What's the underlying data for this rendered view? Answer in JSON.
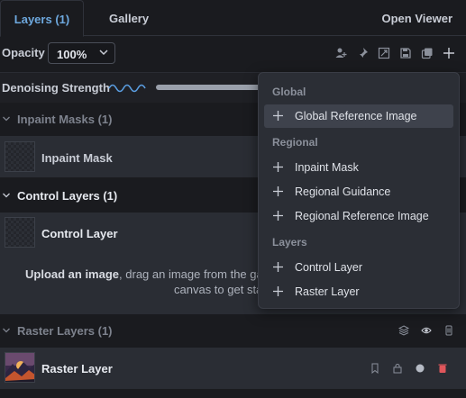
{
  "tabs": {
    "layers": "Layers (1)",
    "gallery": "Gallery",
    "open_viewer": "Open Viewer"
  },
  "opacity": {
    "label": "Opacity",
    "value": "100%"
  },
  "denoising": {
    "label": "Denoising Strength"
  },
  "sections": {
    "inpaint_masks": {
      "title": "Inpaint Masks (1)",
      "layer_name": "Inpaint Mask"
    },
    "control_layers": {
      "title": "Control Layers (1)",
      "layer_name": "Control Layer",
      "upload_bold": "Upload an image",
      "upload_rest": ", drag an image from the gal",
      "upload_line2": "canvas to get sta"
    },
    "raster_layers": {
      "title": "Raster Layers (1)",
      "layer_name": "Raster Layer"
    }
  },
  "menu": {
    "global_label": "Global",
    "global_items": [
      "Global Reference Image"
    ],
    "regional_label": "Regional",
    "regional_items": [
      "Inpaint Mask",
      "Regional Guidance",
      "Regional Reference Image"
    ],
    "layers_label": "Layers",
    "layers_items": [
      "Control Layer",
      "Raster Layer"
    ],
    "highlighted": "Global Reference Image"
  },
  "colors": {
    "accent": "#6ea9df",
    "background": "#1a1b1f",
    "card": "#2a2d34",
    "menu": "#2b2e35",
    "delete": "#e0565b"
  },
  "icons": {
    "toolbar": [
      "user-plus-icon",
      "pin-icon",
      "resize-icon",
      "save-icon",
      "copy-icon",
      "add-icon"
    ],
    "raster_header": [
      "stack-icon",
      "eye-icon",
      "trash-can-icon"
    ],
    "raster_row": [
      "bookmark-icon",
      "lock-icon",
      "circle-icon",
      "delete-icon"
    ]
  }
}
